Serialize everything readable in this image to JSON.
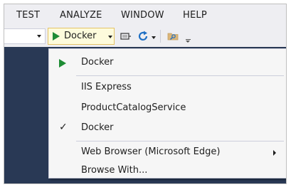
{
  "menubar": {
    "items": [
      "TEST",
      "ANALYZE",
      "WINDOW",
      "HELP"
    ]
  },
  "toolbar": {
    "start_debug": {
      "label": "Docker",
      "icon": "play-icon"
    },
    "icons": [
      "browser-link-icon",
      "refresh-icon",
      "find-in-files-icon",
      "overflow-icon"
    ]
  },
  "dropdown": {
    "items": [
      {
        "label": "Docker",
        "marker": "play",
        "icon": "play-icon"
      },
      {
        "label": "IIS Express",
        "marker": ""
      },
      {
        "label": "ProductCatalogService",
        "marker": ""
      },
      {
        "label": "Docker",
        "marker": "✓",
        "icon": "checkmark-icon"
      },
      {
        "label": "Web Browser (Microsoft Edge)",
        "marker": "",
        "submenu": true
      },
      {
        "label": "Browse With...",
        "marker": ""
      }
    ]
  },
  "colors": {
    "accent_green": "#1e8c34",
    "editor_bg": "#293955",
    "chrome_bg": "#eeeef2",
    "run_button_bg": "#fdfbdc",
    "run_button_border": "#e5c365"
  }
}
